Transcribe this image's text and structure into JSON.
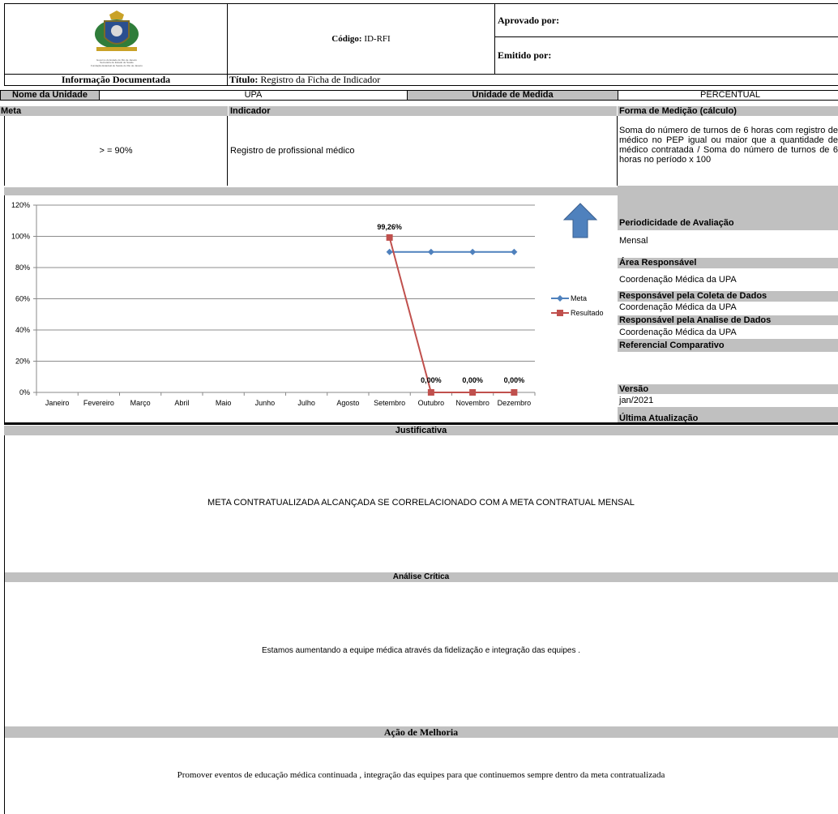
{
  "header": {
    "logo_small_text_1": "Governo do Estado do Rio de Janeiro",
    "logo_small_text_2": "Secretaria de Estado de Saúde",
    "logo_small_text_3": "Fundação Estadual de Saúde do Rio de Janeiro",
    "codigo_label": "Código:",
    "codigo_value": "ID-RFI",
    "aprovado_label": "Aprovado por:",
    "emitido_label": "Emitido por:",
    "info_doc": "Informação Documentada",
    "titulo_label": "Título:",
    "titulo_value": "Registro da Ficha de Indicador"
  },
  "unit_row": {
    "nome_label": "Nome da Unidade",
    "nome_value": "UPA",
    "unidade_label": "Unidade de Medida",
    "unidade_value": "PERCENTUAL"
  },
  "meta_row": {
    "meta_label": "Meta",
    "meta_value": "> = 90%",
    "indicador_label": "Indicador",
    "indicador_value": "Registro de profissional médico",
    "forma_label": "Forma de Medição (cálculo)",
    "forma_value": "Soma do número de turnos de 6 horas com registro de médico no PEP igual ou maior que a quantidade de médico contratada / Soma do número de turnos de 6 horas no período x 100"
  },
  "side_panel": {
    "periodicidade_label": "Periodicidade de Avaliação",
    "periodicidade_value": "Mensal",
    "area_label": "Área Responsável",
    "area_value": "Coordenação Médica da UPA",
    "coleta_label": "Responsável pela Coleta de Dados",
    "coleta_value": "Coordenação Médica da UPA",
    "analise_label": "Responsável pela Analise de Dados",
    "analise_value": "Coordenação Médica da UPA",
    "referencial_label": "Referencial Comparativo",
    "versao_label": "Versão",
    "versao_value": "jan/2021",
    "ultima_label": "Última Atualização"
  },
  "chart_data": {
    "type": "line",
    "categories": [
      "Janeiro",
      "Fevereiro",
      "Março",
      "Abril",
      "Maio",
      "Junho",
      "Julho",
      "Agosto",
      "Setembro",
      "Outubro",
      "Novembro",
      "Dezembro"
    ],
    "series": [
      {
        "name": "Meta",
        "color": "#4f81bd",
        "values": [
          null,
          null,
          null,
          null,
          null,
          null,
          null,
          null,
          90,
          90,
          90,
          90
        ]
      },
      {
        "name": "Resultado",
        "color": "#c0504d",
        "values": [
          null,
          null,
          null,
          null,
          null,
          null,
          null,
          null,
          99.26,
          0,
          0,
          0
        ]
      }
    ],
    "data_labels": [
      "",
      "",
      "",
      "",
      "",
      "",
      "",
      "",
      "99,26%",
      "0,00%",
      "0,00%",
      "0,00%"
    ],
    "yticks": [
      "0%",
      "20%",
      "40%",
      "60%",
      "80%",
      "100%",
      "120%"
    ],
    "ylim": [
      0,
      120
    ],
    "grid": true,
    "legend": "right",
    "arrow_icon": "up-arrow-icon",
    "arrow_color": "#4f81bd"
  },
  "justificativa": {
    "label": "Justificativa",
    "text": "META CONTRATUALIZADA ALCANÇADA SE CORRELACIONADO COM A META CONTRATUAL MENSAL"
  },
  "analise": {
    "label": "Análise Crítica",
    "text": "Estamos aumentando a equipe médica através da fidelização e integração das equipes ."
  },
  "acao": {
    "label": "Ação de Melhoria",
    "text": "Promover eventos de educação médica continuada , integração das equipes para que continuemos sempre dentro da meta contratualizada"
  }
}
